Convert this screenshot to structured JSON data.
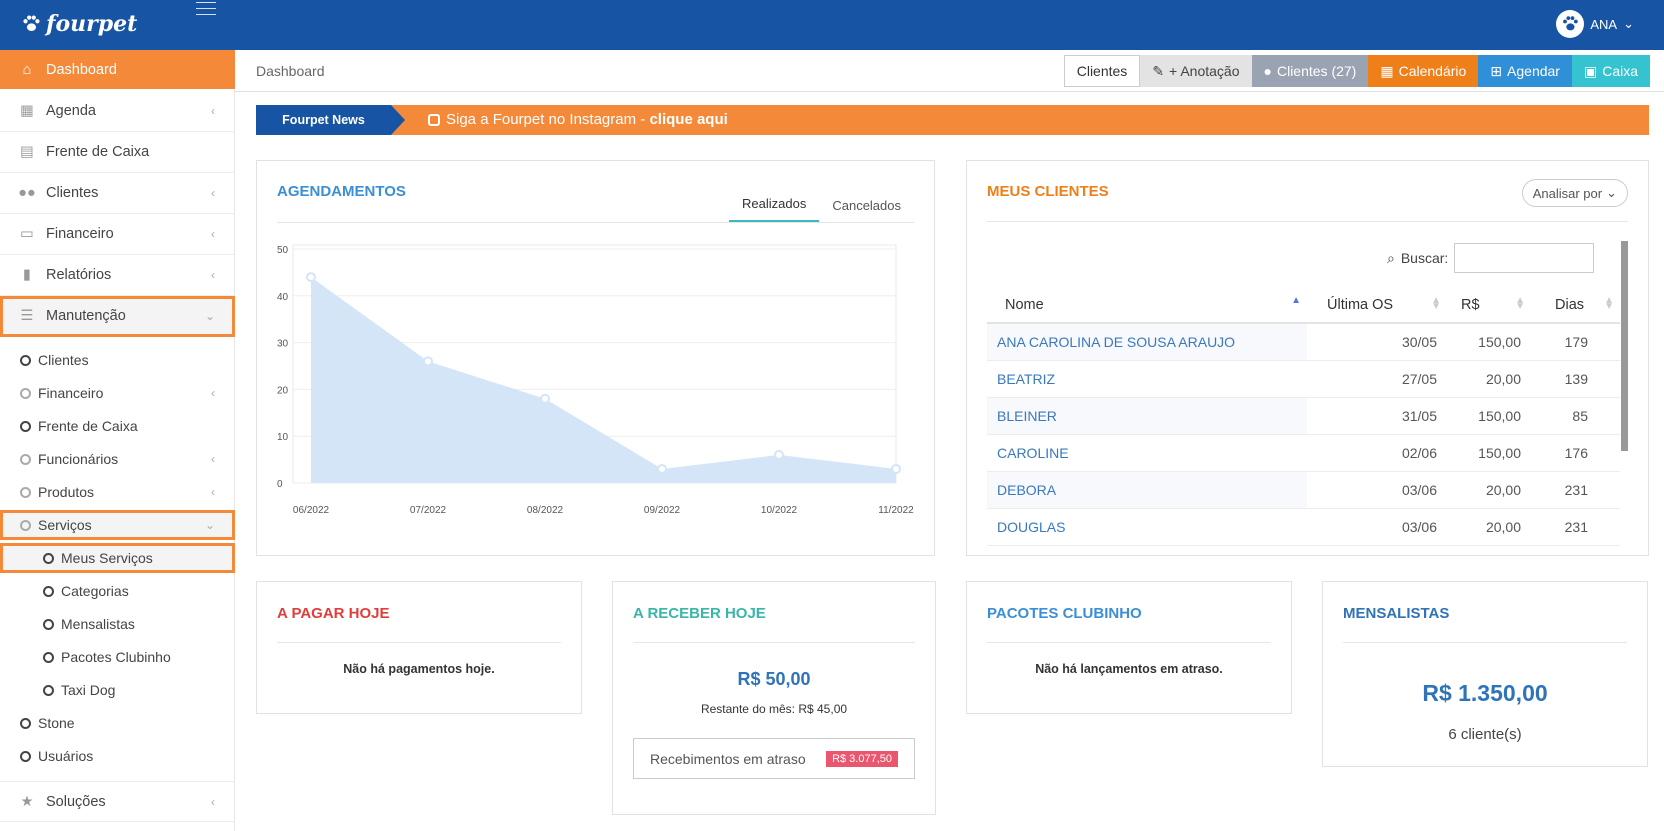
{
  "app": {
    "logo_text": "fourpet",
    "user_name": "ANA"
  },
  "sidebar": {
    "items": [
      {
        "label": "Dashboard",
        "icon": "home-icon"
      },
      {
        "label": "Agenda",
        "icon": "calendar-icon"
      },
      {
        "label": "Frente de Caixa",
        "icon": "calculator-icon"
      },
      {
        "label": "Clientes",
        "icon": "users-icon"
      },
      {
        "label": "Financeiro",
        "icon": "money-icon"
      },
      {
        "label": "Relatórios",
        "icon": "bar-chart-icon"
      },
      {
        "label": "Manutenção",
        "icon": "database-icon"
      },
      {
        "label": "Soluções",
        "icon": "star-icon"
      }
    ],
    "sub_items": [
      "Clientes",
      "Financeiro",
      "Frente de Caixa",
      "Funcionários",
      "Produtos",
      "Serviços"
    ],
    "servicos_items": [
      "Meus Serviços",
      "Categorias",
      "Mensalistas",
      "Pacotes Clubinho",
      "Taxi Dog"
    ],
    "tail_items": [
      "Stone",
      "Usuários"
    ]
  },
  "header": {
    "breadcrumb": "Dashboard",
    "buttons": {
      "clientes": "Clientes",
      "anotacao": "+ Anotação",
      "clientes_count": "Clientes (27)",
      "calendario": "Calendário",
      "agendar": "Agendar",
      "caixa": "Caixa"
    }
  },
  "news": {
    "tag": "Fourpet News",
    "text": "Siga a Fourpet no Instagram - ",
    "link": "clique aqui"
  },
  "agendamentos": {
    "title": "AGENDAMENTOS",
    "tabs": [
      "Realizados",
      "Cancelados"
    ]
  },
  "chart_data": {
    "type": "area",
    "x": [
      "06/2022",
      "07/2022",
      "08/2022",
      "09/2022",
      "10/2022",
      "11/2022"
    ],
    "values": [
      44,
      26,
      18,
      3,
      6,
      3
    ],
    "y_ticks": [
      "0",
      "10",
      "20",
      "30",
      "40",
      "50"
    ],
    "ylim": [
      0,
      50
    ],
    "grid": true,
    "fill_color": "#d4e5f7",
    "point_color": "#d4e5f7"
  },
  "meus_clientes": {
    "title": "MEUS CLIENTES",
    "analisar_label": "Analisar por",
    "search_label": "Buscar:",
    "search_value": "",
    "columns": [
      "Nome",
      "Última OS",
      "R$",
      "Dias"
    ],
    "rows": [
      {
        "nome": "ANA CAROLINA DE SOUSA ARAUJO",
        "ultima_os": "30/05",
        "valor": "150,00",
        "dias": "179"
      },
      {
        "nome": "BEATRIZ",
        "ultima_os": "27/05",
        "valor": "20,00",
        "dias": "139"
      },
      {
        "nome": "BLEINER",
        "ultima_os": "31/05",
        "valor": "150,00",
        "dias": "85"
      },
      {
        "nome": "CAROLINE",
        "ultima_os": "02/06",
        "valor": "150,00",
        "dias": "176"
      },
      {
        "nome": "DEBORA",
        "ultima_os": "03/06",
        "valor": "20,00",
        "dias": "231"
      },
      {
        "nome": "DOUGLAS",
        "ultima_os": "03/06",
        "valor": "20,00",
        "dias": "231"
      }
    ]
  },
  "a_pagar": {
    "title": "A PAGAR HOJE",
    "message": "Não há pagamentos hoje."
  },
  "a_receber": {
    "title": "A RECEBER HOJE",
    "amount": "R$ 50,00",
    "restante": "Restante do mês: R$ 45,00",
    "atraso_label": "Recebimentos em atraso",
    "atraso_value": "R$ 3.077,50"
  },
  "pacotes": {
    "title": "PACOTES CLUBINHO",
    "message": "Não há lançamentos em atraso."
  },
  "mensalistas": {
    "title": "MENSALISTAS",
    "amount": "R$ 1.350,00",
    "clients": "6 cliente(s)"
  },
  "colors": {
    "brand_blue": "#1854a4",
    "accent_orange": "#f5893a",
    "link_blue": "#3a78bf",
    "red": "#e23d3d",
    "teal": "#39b6a8"
  }
}
